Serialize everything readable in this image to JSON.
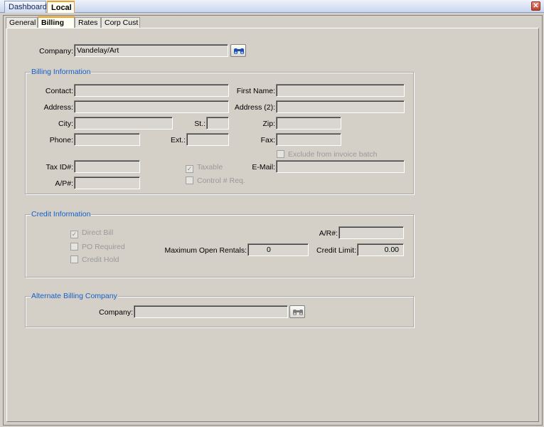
{
  "top_tabs": [
    "Dashboard",
    "Local"
  ],
  "sub_tabs": [
    "General",
    "Billing",
    "Rates",
    "Corp Cust"
  ],
  "company": {
    "label": "Company:",
    "value": "Vandelay/Art"
  },
  "billing": {
    "title": "Billing Information",
    "contact_label": "Contact:",
    "first_name_label": "First Name:",
    "address_label": "Address:",
    "address2_label": "Address (2):",
    "city_label": "City:",
    "st_label": "St.:",
    "zip_label": "Zip:",
    "phone_label": "Phone:",
    "ext_label": "Ext.:",
    "fax_label": "Fax:",
    "exclude_label": "Exclude from invoice batch",
    "exclude_checked": false,
    "taxid_label": "Tax ID#:",
    "taxable_label": "Taxable",
    "taxable_checked": true,
    "email_label": "E-Mail:",
    "ap_label": "A/P#:",
    "control_label": "Control # Req.",
    "control_checked": false
  },
  "credit": {
    "title": "Credit Information",
    "direct_bill_label": "Direct Bill",
    "direct_bill_checked": true,
    "po_required_label": "PO Required",
    "po_required_checked": false,
    "credit_hold_label": "Credit Hold",
    "credit_hold_checked": false,
    "ar_label": "A/R#:",
    "max_open_label": "Maximum Open Rentals:",
    "max_open_value": "0",
    "credit_limit_label": "Credit Limit:",
    "credit_limit_value": "0.00"
  },
  "alternate": {
    "title": "Alternate Billing Company",
    "company_label": "Company:",
    "company_value": ""
  }
}
